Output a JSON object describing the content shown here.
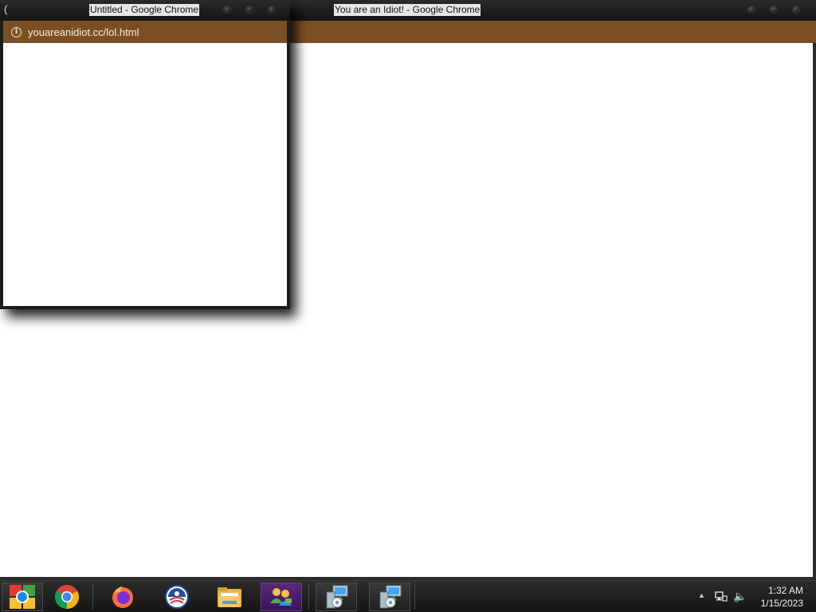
{
  "main_window": {
    "title": "You are an Idiot! - Google Chrome",
    "urlbar_color": "#7b4f23"
  },
  "popup_window": {
    "title": "Untitled - Google Chrome",
    "app_glyph": "(",
    "url": "youareanidiot.cc/lol.html",
    "icons": [
      "info-icon"
    ]
  },
  "taskbar": {
    "items": [
      {
        "name": "start-button",
        "icon": "chrome-start-icon"
      },
      {
        "name": "chrome",
        "icon": "chrome-icon"
      },
      {
        "name": "firefox",
        "icon": "firefox-icon"
      },
      {
        "name": "obama",
        "icon": "obama-logo-icon"
      },
      {
        "name": "file-explorer",
        "icon": "folder-icon"
      },
      {
        "name": "messenger",
        "icon": "people-icon"
      },
      {
        "name": "installer-1",
        "icon": "installer-icon"
      },
      {
        "name": "installer-2",
        "icon": "installer-icon"
      }
    ],
    "tray": {
      "icons": [
        "show-hidden-icons-arrow",
        "network-icon",
        "volume-icon"
      ],
      "time": "1:32 AM",
      "date": "1/15/2023"
    }
  }
}
